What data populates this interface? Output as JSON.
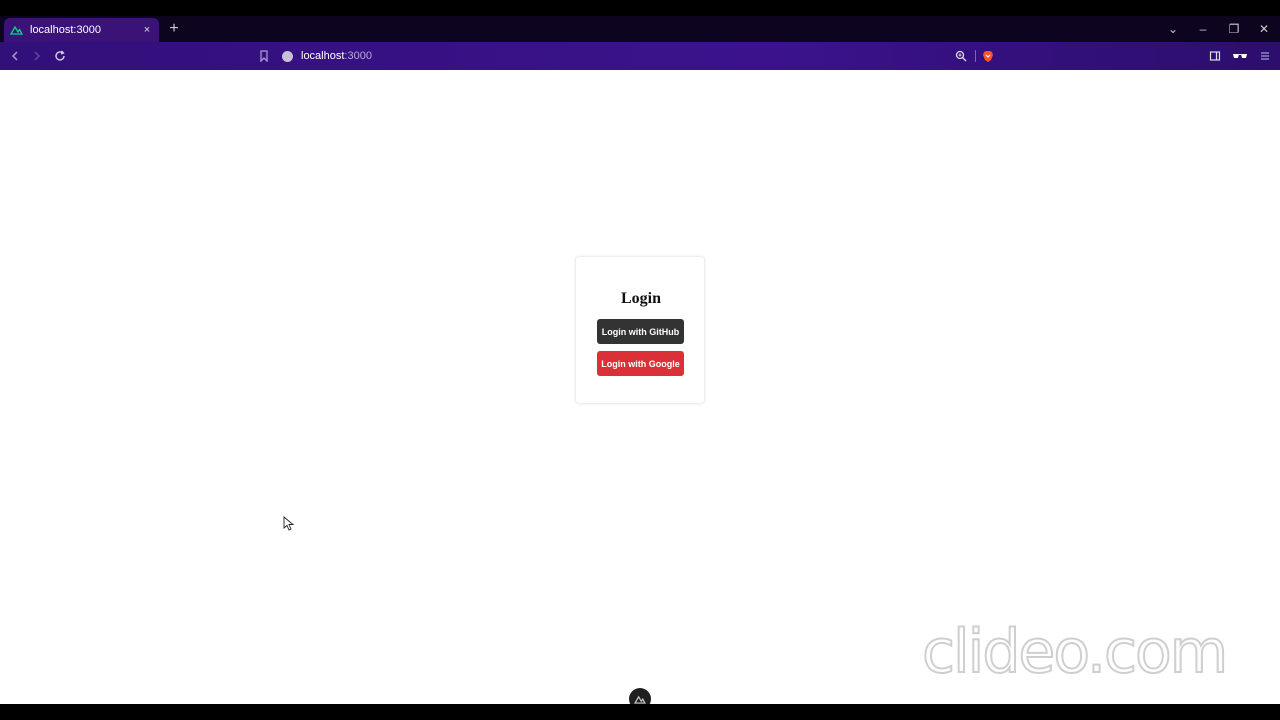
{
  "tab": {
    "title": "localhost:3000",
    "close_symbol": "×"
  },
  "new_tab_symbol": "+",
  "window_controls": {
    "dropdown": "⌄",
    "minimize": "–",
    "restore": "❐",
    "close": "✕"
  },
  "address_bar": {
    "host": "localhost",
    "port": ":3000"
  },
  "login": {
    "title": "Login",
    "github_button": "Login with GitHub",
    "google_button": "Login with Google"
  },
  "watermark": {
    "text": "clideo.com"
  },
  "colors": {
    "tab_active": "#3a1278",
    "toolbar": "#3b128c",
    "github_button": "#333333",
    "google_button": "#db3038"
  },
  "icons": [
    "nuxt-logo-icon",
    "back-icon",
    "forward-icon",
    "reload-icon",
    "bookmark-icon",
    "site-info-icon",
    "zoom-icon",
    "brave-shield-icon",
    "sidebar-icon",
    "wallet-icon",
    "menu-icon",
    "cursor-icon",
    "nuxt-devtools-icon"
  ]
}
